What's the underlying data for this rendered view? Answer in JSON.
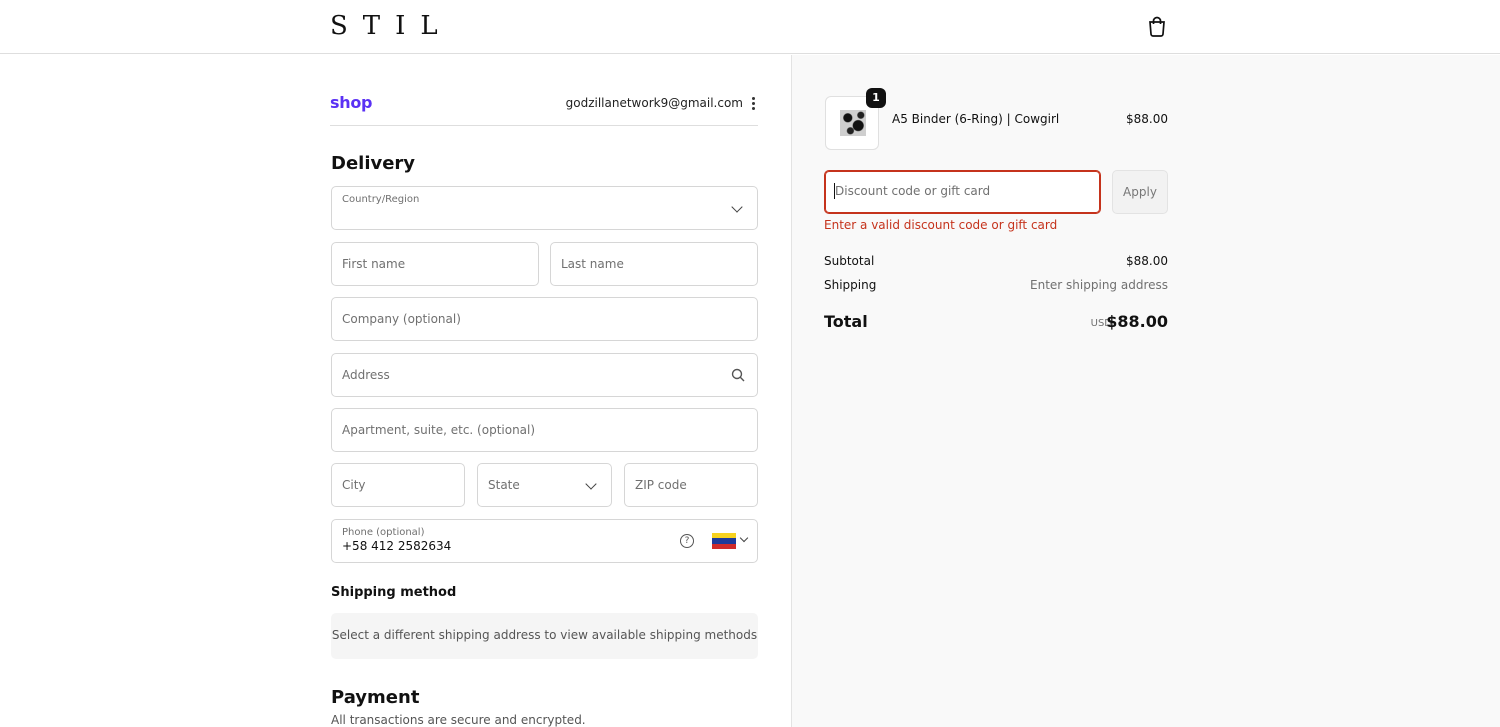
{
  "store": {
    "logo_text": "STIL"
  },
  "header": {
    "bag_icon": "shopping-bag-icon"
  },
  "shop_pay": {
    "logo": "shop",
    "email": "godzillanetwork9@gmail.com"
  },
  "delivery": {
    "title": "Delivery",
    "country_label": "Country/Region",
    "first_name_placeholder": "First name",
    "last_name_placeholder": "Last name",
    "company_placeholder": "Company (optional)",
    "address_placeholder": "Address",
    "apartment_placeholder": "Apartment, suite, etc. (optional)",
    "city_placeholder": "City",
    "state_placeholder": "State",
    "zip_placeholder": "ZIP code",
    "phone_label": "Phone (optional)",
    "phone_value": "+58 412 2582634"
  },
  "shipping_method": {
    "title": "Shipping method",
    "message": "Select a different shipping address to view available shipping methods"
  },
  "payment": {
    "title": "Payment",
    "subtitle": "All transactions are secure and encrypted."
  },
  "order": {
    "item": {
      "quantity": "1",
      "name": "A5 Binder (6-Ring) | Cowgirl",
      "price": "$88.00"
    },
    "discount_placeholder": "Discount code or gift card",
    "apply_label": "Apply",
    "discount_error": "Enter a valid discount code or gift card",
    "subtotal_label": "Subtotal",
    "subtotal_value": "$88.00",
    "shipping_label": "Shipping",
    "shipping_value": "Enter shipping address",
    "total_label": "Total",
    "total_currency": "USD",
    "total_value": "$88.00"
  },
  "colors": {
    "shop_brand": "#5a31f4",
    "error": "#c5331c",
    "flag_yellow": "#f7d21f",
    "flag_blue": "#1d3a9b",
    "flag_red": "#cf2b2b"
  }
}
